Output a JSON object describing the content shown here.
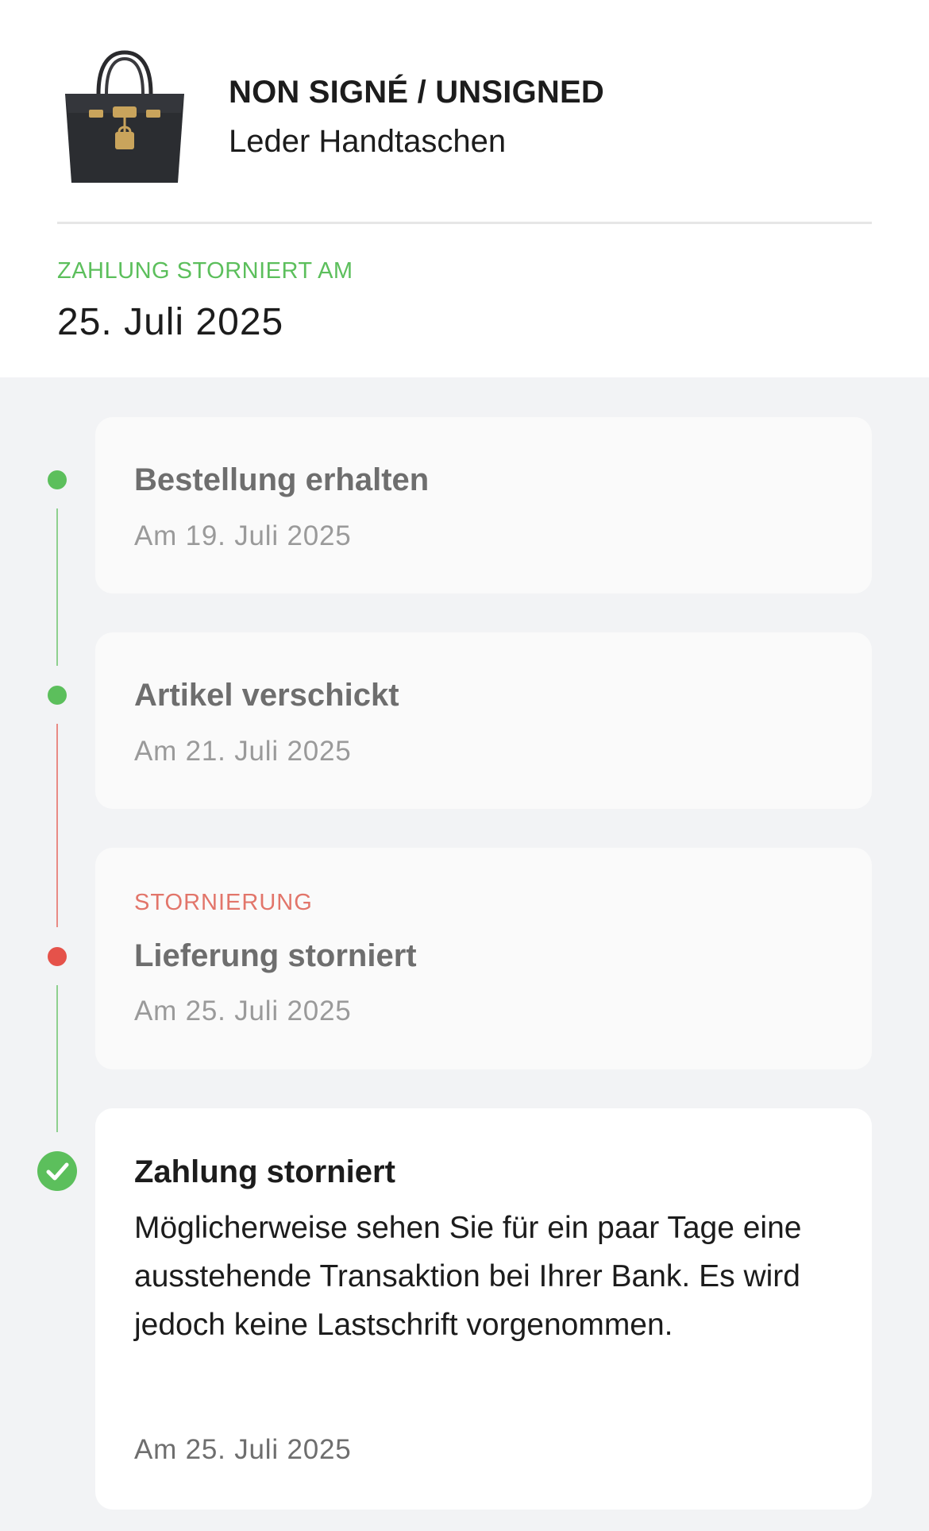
{
  "product": {
    "brand": "NON SIGNÉ / UNSIGNED",
    "category": "Leder Handtaschen",
    "image_icon": "black-handbag-icon"
  },
  "status": {
    "label": "ZAHLUNG STORNIERT AM",
    "date": "25. Juli 2025",
    "color": "#5cbf5c"
  },
  "timeline": {
    "colors": {
      "done": "#5cbf5c",
      "cancelled": "#e5524a"
    },
    "steps": [
      {
        "title": "Bestellung erhalten",
        "date": "Am 19. Juli 2025",
        "state": "done"
      },
      {
        "title": "Artikel verschickt",
        "date": "Am 21. Juli 2025",
        "state": "done"
      },
      {
        "tag": "STORNIERUNG",
        "title": "Lieferung storniert",
        "date": "Am 25. Juli 2025",
        "state": "cancelled"
      },
      {
        "title": "Zahlung storniert",
        "description": "Möglicherweise sehen Sie für ein paar Tage eine ausstehende Transaktion bei Ihrer Bank. Es wird jedoch keine Lastschrift vorgenommen.",
        "date": "Am 25. Juli 2025",
        "state": "current"
      }
    ]
  }
}
